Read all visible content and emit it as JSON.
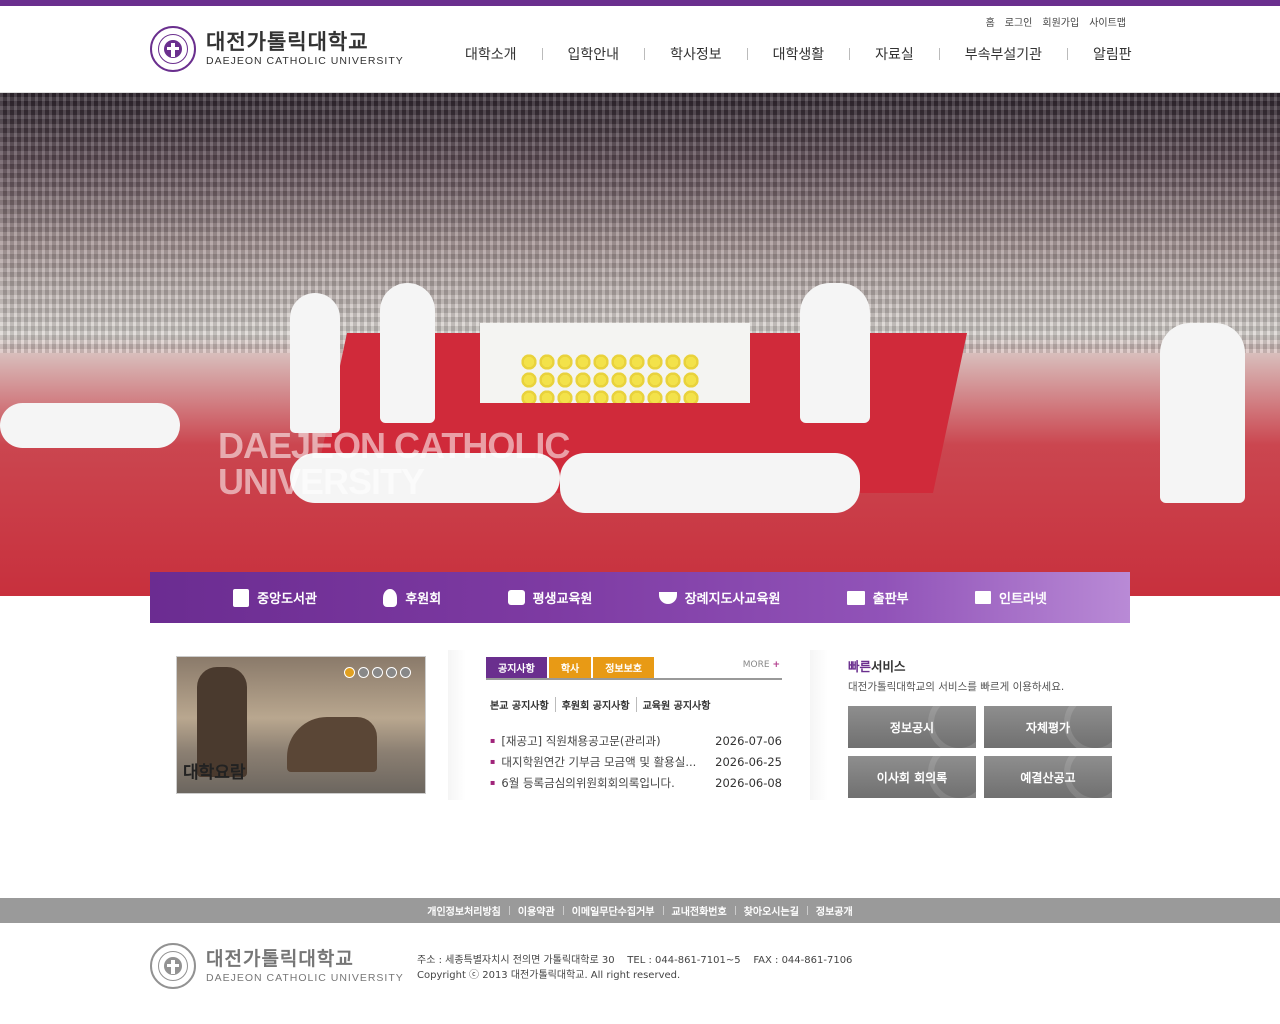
{
  "util": [
    "홈",
    "로그인",
    "회원가입",
    "사이트맵"
  ],
  "logo": {
    "ko": "대전가톨릭대학교",
    "en": "DAEJEON CATHOLIC UNIVERSITY"
  },
  "gnb": [
    "대학소개",
    "입학안내",
    "학사정보",
    "대학생활",
    "자료실",
    "부속부설기관",
    "알림판"
  ],
  "hero": {
    "caption_line1": "DAEJEON CATHOLIC",
    "caption_line2": "UNIVERSITY"
  },
  "quickbar": [
    {
      "label": "중앙도서관",
      "icon": "book-icon"
    },
    {
      "label": "후원회",
      "icon": "person-icon"
    },
    {
      "label": "평생교육원",
      "icon": "bag-icon"
    },
    {
      "label": "장례지도사교육원",
      "icon": "dove-icon"
    },
    {
      "label": "출판부",
      "icon": "open-book-icon"
    },
    {
      "label": "인트라넷",
      "icon": "computer-icon"
    }
  ],
  "guide": {
    "label": "대학요람",
    "slides": 5,
    "active": 1
  },
  "notice": {
    "tabs": [
      "공지사항",
      "학사",
      "정보보호"
    ],
    "more": "MORE",
    "subtabs": [
      "본교 공지사항",
      "후원회 공지사항",
      "교육원 공지사항"
    ],
    "items": [
      {
        "title": "[재공고] 직원채용공고문(관리과)",
        "date": "2026-07-06"
      },
      {
        "title": "대지학원연간 기부금 모금액 및 활용실...",
        "date": "2026-06-25"
      },
      {
        "title": "6월 등록금심의위원회회의록입니다.",
        "date": "2026-06-08"
      }
    ]
  },
  "quick": {
    "title_accent": "빠른",
    "title_rest": "서비스",
    "desc": "대전가톨릭대학교의 서비스를 빠르게 이용하세요.",
    "buttons": [
      "정보공시",
      "자체평가",
      "이사회 회의록",
      "예결산공고"
    ]
  },
  "footer": {
    "links": [
      "개인정보처리방침",
      "이용약관",
      "이메일무단수집거부",
      "교내전화번호",
      "찾아오시는길",
      "정보공개"
    ],
    "address": "주소 : 세종특별자치시 전의면 가톨릭대학로 30    TEL : 044-861-7101~5    FAX : 044-861-7106",
    "copyright": "Copyright ⓒ 2013 대전가톨릭대학교. All right reserved."
  },
  "colors": {
    "brand": "#6a2f8e",
    "accent": "#e89a15"
  }
}
